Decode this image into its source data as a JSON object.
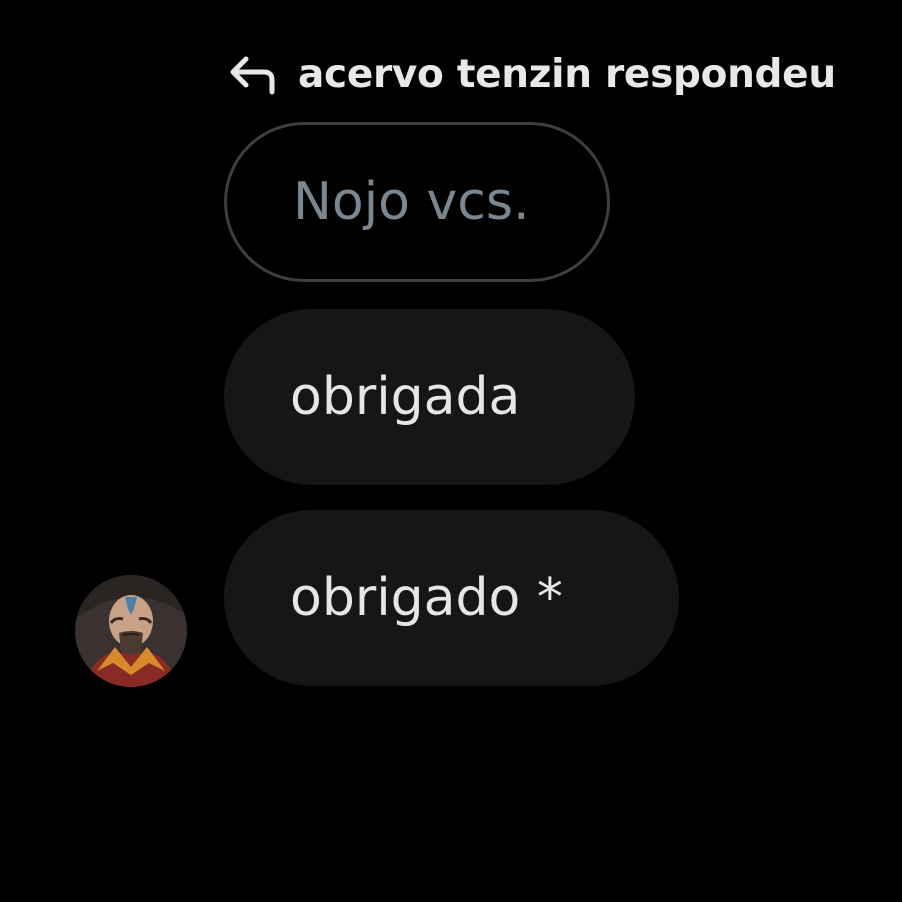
{
  "reply_header": {
    "icon": "reply-arrow-icon",
    "text": "acervo tenzin respondeu"
  },
  "quoted_message": {
    "text": "Nojo vcs."
  },
  "messages": [
    {
      "text": "obrigada"
    },
    {
      "text": "obrigado *"
    }
  ],
  "avatar": {
    "icon": "user-avatar"
  },
  "colors": {
    "background": "#000000",
    "bubble": "#161616",
    "quoted_border": "#3b3f42",
    "quoted_text": "#7a8791",
    "message_text": "#e6e6e6"
  }
}
